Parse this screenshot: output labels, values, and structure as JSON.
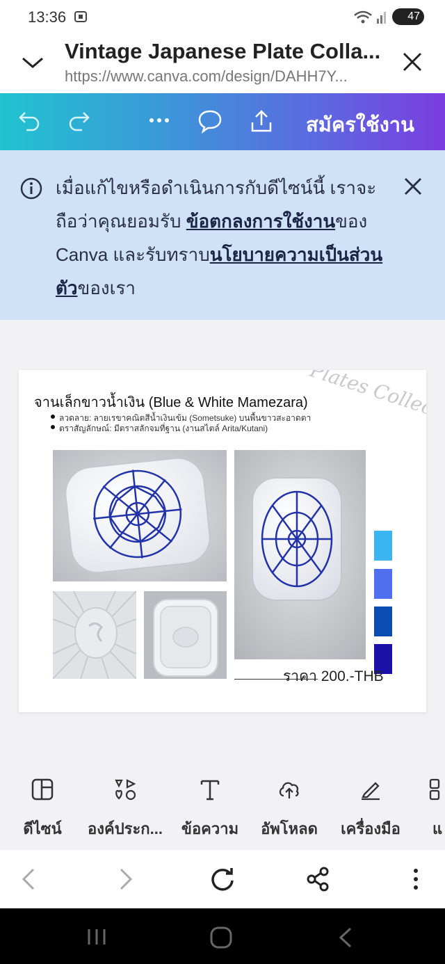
{
  "status_bar": {
    "time": "13:36",
    "battery": "47"
  },
  "browser": {
    "page_title": "Vintage Japanese Plate Colla...",
    "url": "https://www.canva.com/design/DAHH7Y..."
  },
  "canva_toolbar": {
    "signup_label": "สมัครใช้งาน"
  },
  "notice": {
    "text_before": "เมื่อแก้ไขหรือดำเนินการกับดีไซน์นี้ เราจะถือว่าคุณยอมรับ ",
    "terms_link": "ข้อตกลงการใช้งาน",
    "text_middle": "ของ Canva และรับทราบ",
    "privacy_link": "นโยบายความเป็นส่วนตัว",
    "text_after": "ของเรา"
  },
  "design": {
    "heading": "จานเล็กขาวน้ำเงิน (Blue & White Mamezara)",
    "bullets": [
      "ลวดลาย: ลายเรขาคณิตสีน้ำเงินเข้ม (Sometsuke) บนพื้นขาวสะอาดตา",
      "ตราสัญลักษณ์: มีตราสลักจมที่ฐาน (งานสไตล์ Arita/Kutani)"
    ],
    "watermark": "Plates Collecti",
    "price": "ราคา 200.-THB",
    "swatches": [
      "#3bb4f2",
      "#4f6ff0",
      "#0b4cb0",
      "#1a12a8"
    ]
  },
  "bottom_tools": [
    {
      "label": "ดีไซน์",
      "icon": "design-icon"
    },
    {
      "label": "องค์ประก...",
      "icon": "elements-icon"
    },
    {
      "label": "ข้อความ",
      "icon": "text-icon"
    },
    {
      "label": "อัพโหลด",
      "icon": "upload-icon"
    },
    {
      "label": "เครื่องมือ",
      "icon": "tools-icon"
    },
    {
      "label": "แ",
      "icon": "more-icon"
    }
  ]
}
